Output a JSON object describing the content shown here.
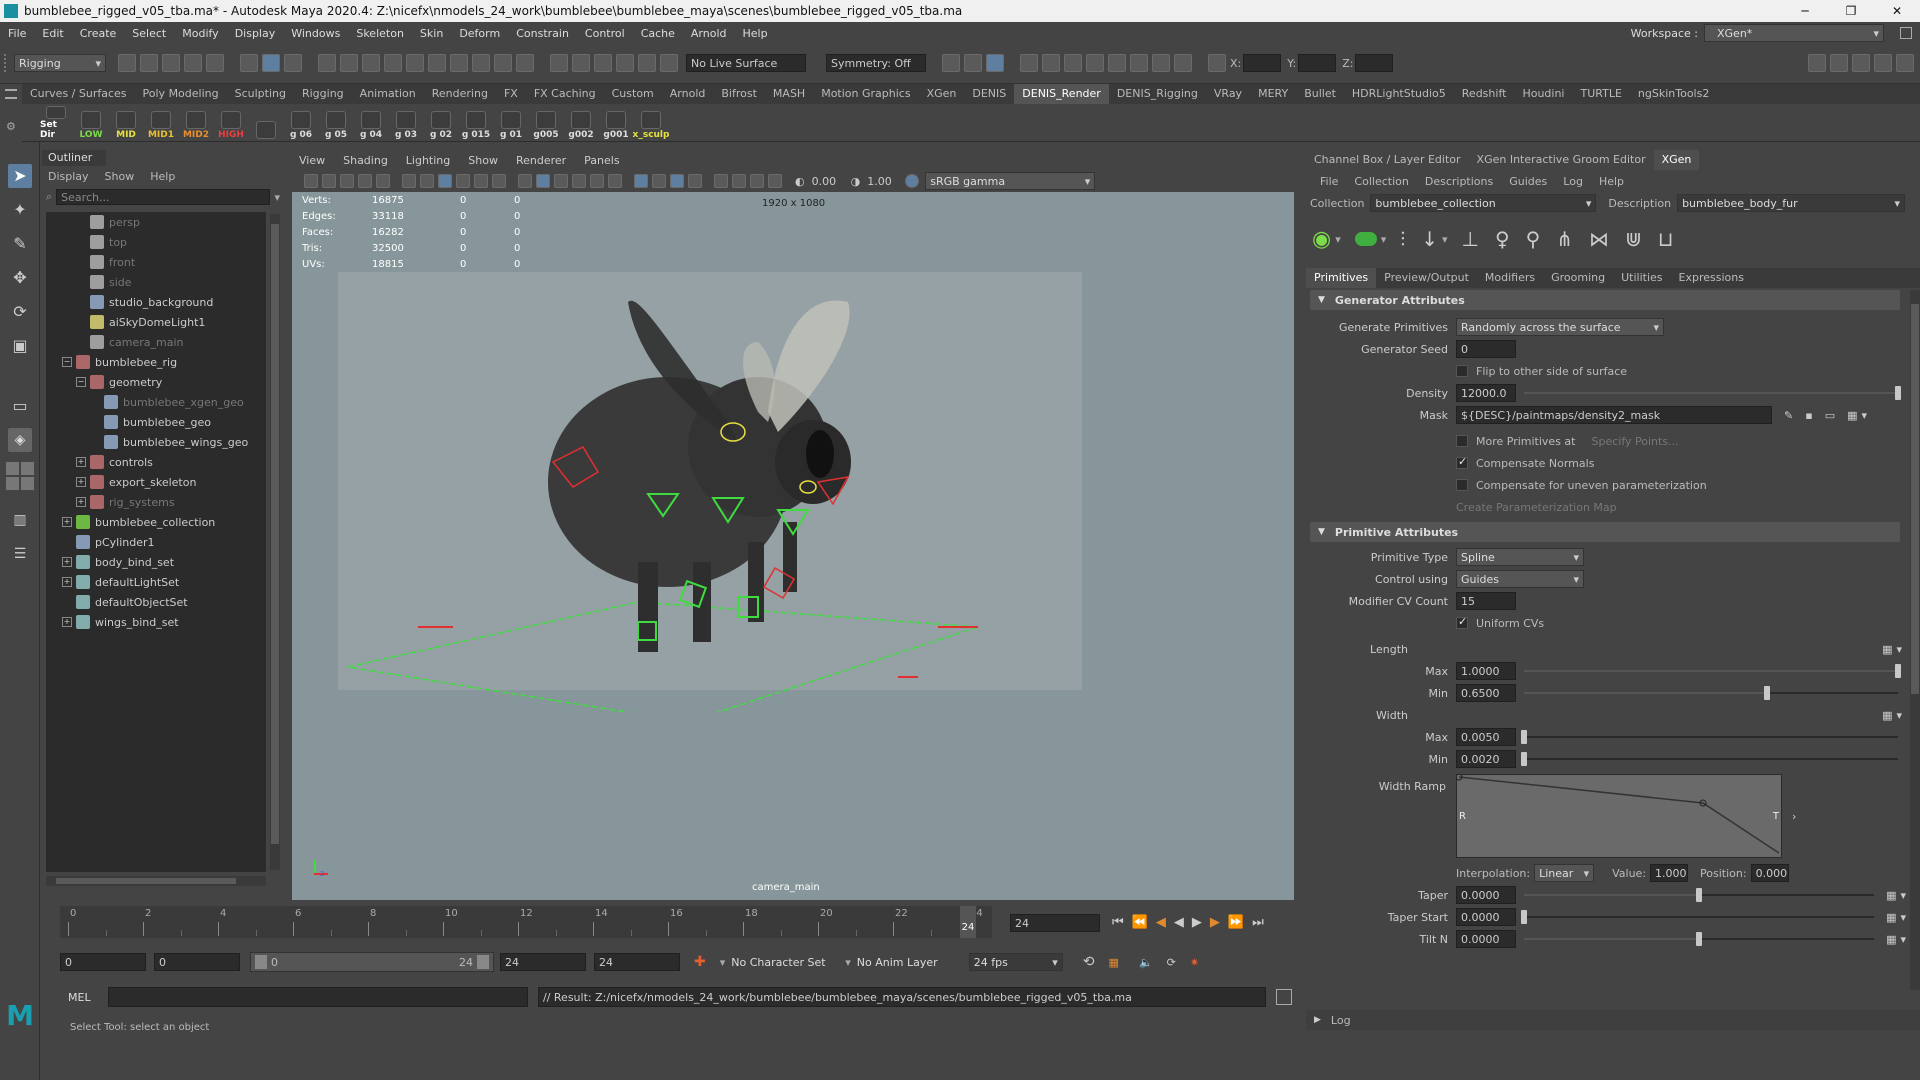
{
  "window": {
    "title": "bumblebee_rigged_v05_tba.ma* - Autodesk Maya 2020.4: Z:\\nicefx\\nmodels_24_work\\bumblebee\\bumblebee_maya\\scenes\\bumblebee_rigged_v05_tba.ma"
  },
  "menubar": [
    "File",
    "Edit",
    "Create",
    "Select",
    "Modify",
    "Display",
    "Windows",
    "Skeleton",
    "Skin",
    "Deform",
    "Constrain",
    "Control",
    "Cache",
    "Arnold",
    "Help"
  ],
  "workspace": {
    "label": "Workspace :",
    "value": "XGen*"
  },
  "status": {
    "mode": "Rigging",
    "live_surface": "No Live Surface",
    "symmetry": "Symmetry: Off",
    "x_label": "X:",
    "y_label": "Y:",
    "z_label": "Z:"
  },
  "shelf_tabs": [
    "Curves / Surfaces",
    "Poly Modeling",
    "Sculpting",
    "Rigging",
    "Animation",
    "Rendering",
    "FX",
    "FX Caching",
    "Custom",
    "Arnold",
    "Bifrost",
    "MASH",
    "Motion Graphics",
    "XGen",
    "DENIS",
    "DENIS_Render",
    "DENIS_Rigging",
    "VRay",
    "MERY",
    "Bullet",
    "HDRLightStudio5",
    "Redshift",
    "Houdini",
    "TURTLE",
    "ngSkinTools2"
  ],
  "shelf_active": "DENIS_Render",
  "shelf_buttons": [
    {
      "label": "Set Dir",
      "color": "#ffffff"
    },
    {
      "label": "LOW",
      "color": "#7ddc4a"
    },
    {
      "label": "MID",
      "color": "#e8e040"
    },
    {
      "label": "MID1",
      "color": "#e8c030"
    },
    {
      "label": "MID2",
      "color": "#e89030"
    },
    {
      "label": "HIGH",
      "color": "#e84040"
    },
    {
      "label": "",
      "color": "#ffffff"
    },
    {
      "label": "g 06",
      "color": "#dddddd"
    },
    {
      "label": "g 05",
      "color": "#dddddd"
    },
    {
      "label": "g 04",
      "color": "#dddddd"
    },
    {
      "label": "g 03",
      "color": "#dddddd"
    },
    {
      "label": "g 02",
      "color": "#dddddd"
    },
    {
      "label": "g 015",
      "color": "#dddddd"
    },
    {
      "label": "g 01",
      "color": "#dddddd"
    },
    {
      "label": "g005",
      "color": "#dddddd"
    },
    {
      "label": "g002",
      "color": "#dddddd"
    },
    {
      "label": "g001",
      "color": "#dddddd"
    },
    {
      "label": "x_sculp",
      "color": "#e8e040"
    }
  ],
  "outliner": {
    "title": "Outliner",
    "menu": [
      "Display",
      "Show",
      "Help"
    ],
    "search_placeholder": "Search...",
    "items": [
      {
        "label": "persp",
        "indent": 1,
        "icon": "camera-icon",
        "dim": true,
        "exp": ""
      },
      {
        "label": "top",
        "indent": 1,
        "icon": "camera-icon",
        "dim": true,
        "exp": ""
      },
      {
        "label": "front",
        "indent": 1,
        "icon": "camera-icon",
        "dim": true,
        "exp": ""
      },
      {
        "label": "side",
        "indent": 1,
        "icon": "camera-icon",
        "dim": true,
        "exp": ""
      },
      {
        "label": "studio_background",
        "indent": 1,
        "icon": "mesh-icon",
        "dim": false,
        "exp": ""
      },
      {
        "label": "aiSkyDomeLight1",
        "indent": 1,
        "icon": "light-icon",
        "dim": false,
        "exp": ""
      },
      {
        "label": "camera_main",
        "indent": 1,
        "icon": "camera-icon",
        "dim": true,
        "exp": ""
      },
      {
        "label": "bumblebee_rig",
        "indent": 0,
        "icon": "group-icon",
        "dim": false,
        "exp": "−"
      },
      {
        "label": "geometry",
        "indent": 1,
        "icon": "group-icon",
        "dim": false,
        "exp": "−"
      },
      {
        "label": "bumblebee_xgen_geo",
        "indent": 2,
        "icon": "mesh-icon",
        "dim": true,
        "exp": ""
      },
      {
        "label": "bumblebee_geo",
        "indent": 2,
        "icon": "mesh-icon",
        "dim": false,
        "exp": ""
      },
      {
        "label": "bumblebee_wings_geo",
        "indent": 2,
        "icon": "mesh-icon",
        "dim": false,
        "exp": ""
      },
      {
        "label": "controls",
        "indent": 1,
        "icon": "group-icon",
        "dim": false,
        "exp": "+"
      },
      {
        "label": "export_skeleton",
        "indent": 1,
        "icon": "group-icon",
        "dim": false,
        "exp": "+"
      },
      {
        "label": "rig_systems",
        "indent": 1,
        "icon": "group-icon",
        "dim": true,
        "exp": "+"
      },
      {
        "label": "bumblebee_collection",
        "indent": 0,
        "icon": "xgen-icon",
        "dim": false,
        "exp": "+"
      },
      {
        "label": "pCylinder1",
        "indent": 0,
        "icon": "mesh-icon",
        "dim": false,
        "exp": ""
      },
      {
        "label": "body_bind_set",
        "indent": 0,
        "icon": "set-icon",
        "dim": false,
        "exp": "+"
      },
      {
        "label": "defaultLightSet",
        "indent": 0,
        "icon": "set-icon",
        "dim": false,
        "exp": "+"
      },
      {
        "label": "defaultObjectSet",
        "indent": 0,
        "icon": "set-icon",
        "dim": false,
        "exp": ""
      },
      {
        "label": "wings_bind_set",
        "indent": 0,
        "icon": "set-icon",
        "dim": false,
        "exp": "+"
      }
    ]
  },
  "viewport": {
    "menu": [
      "View",
      "Shading",
      "Lighting",
      "Show",
      "Renderer",
      "Panels"
    ],
    "exposure": "0.00",
    "gamma": "1.00",
    "color_space": "sRGB gamma",
    "resolution": "1920 x 1080",
    "camera": "camera_main",
    "hud": [
      {
        "k": "Verts:",
        "a": "16875",
        "b": "0",
        "c": "0"
      },
      {
        "k": "Edges:",
        "a": "33118",
        "b": "0",
        "c": "0"
      },
      {
        "k": "Faces:",
        "a": "16282",
        "b": "0",
        "c": "0"
      },
      {
        "k": "Tris:",
        "a": "32500",
        "b": "0",
        "c": "0"
      },
      {
        "k": "UVs:",
        "a": "18815",
        "b": "0",
        "c": "0"
      }
    ]
  },
  "timeline": {
    "ticks": [
      "0",
      "2",
      "4",
      "6",
      "8",
      "10",
      "12",
      "14",
      "16",
      "18",
      "20",
      "22",
      "24"
    ],
    "current": "24",
    "current_field": "24"
  },
  "range": {
    "start": "0",
    "start2": "0",
    "slider_start": "0",
    "slider_end": "24",
    "end": "24",
    "end2": "24",
    "character_set": "No Character Set",
    "anim_layer": "No Anim Layer",
    "fps": "24 fps"
  },
  "cmdline": {
    "lang": "MEL",
    "result": "// Result: Z:/nicefx/nmodels_24_work/bumblebee/bumblebee_maya/scenes/bumblebee_rigged_v05_tba.ma"
  },
  "helpline": "Select Tool: select an object",
  "right": {
    "tabs": [
      "Channel Box / Layer Editor",
      "XGen Interactive Groom Editor",
      "XGen"
    ],
    "active_tab": "XGen",
    "menu": [
      "File",
      "Collection",
      "Descriptions",
      "Guides",
      "Log",
      "Help"
    ],
    "collection_label": "Collection",
    "collection": "bumblebee_collection",
    "description_label": "Description",
    "description": "bumblebee_body_fur",
    "subtabs": [
      "Primitives",
      "Preview/Output",
      "Modifiers",
      "Grooming",
      "Utilities",
      "Expressions"
    ],
    "gen_section": "Generator Attributes",
    "generate_primitives_label": "Generate Primitives",
    "generate_primitives": "Randomly across the surface",
    "seed_label": "Generator Seed",
    "seed": "0",
    "flip_label": "Flip to other side of surface",
    "density_label": "Density",
    "density": "12000.0",
    "density_level": 1.0,
    "mask_label": "Mask",
    "mask": "${DESC}/paintmaps/density2_mask",
    "more_prims_label": "More Primitives at",
    "specify_points": "Specify Points...",
    "comp_normals_label": "Compensate Normals",
    "comp_param_label": "Compensate for uneven parameterization",
    "create_param_map": "Create Parameterization Map",
    "prim_section": "Primitive Attributes",
    "prim_type_label": "Primitive Type",
    "prim_type": "Spline",
    "control_label": "Control using",
    "control": "Guides",
    "cv_count_label": "Modifier CV Count",
    "cv_count": "15",
    "uniform_cvs_label": "Uniform CVs",
    "length_label": "Length",
    "len_max_label": "Max",
    "len_max": "1.0000",
    "len_max_level": 1.0,
    "len_min_label": "Min",
    "len_min": "0.6500",
    "len_min_level": 0.65,
    "width_label": "Width",
    "w_max_label": "Max",
    "w_max": "0.0050",
    "w_max_level": 0.0,
    "w_min_label": "Min",
    "w_min": "0.0020",
    "w_min_level": 0.0,
    "width_ramp_label": "Width Ramp",
    "ramp_r": "R",
    "ramp_t": "T",
    "interp_label": "Interpolation:",
    "interp": "Linear",
    "value_label": "Value:",
    "value": "1.000",
    "position_label": "Position:",
    "position": "0.000",
    "taper_label": "Taper",
    "taper": "0.0000",
    "taper_level": 0.5,
    "taper_start_label": "Taper Start",
    "taper_start": "0.0000",
    "taper_start_level": 0.0,
    "tilt_label": "Tilt N",
    "tilt": "0.0000",
    "tilt_level": 0.5,
    "log_label": "Log"
  }
}
